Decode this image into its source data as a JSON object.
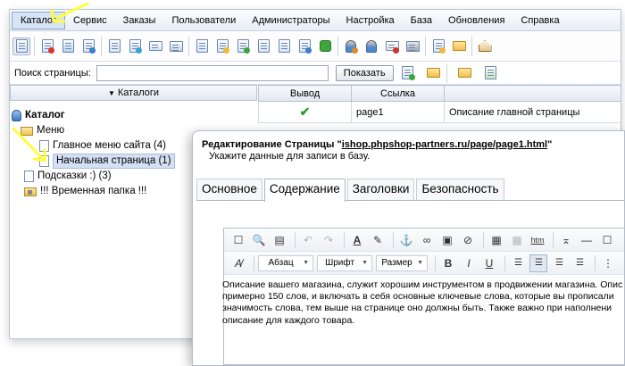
{
  "menu": {
    "items": [
      {
        "label": "Каталог",
        "active": true
      },
      {
        "label": "Сервис"
      },
      {
        "label": "Заказы"
      },
      {
        "label": "Пользователи"
      },
      {
        "label": "Администраторы"
      },
      {
        "label": "Настройка"
      },
      {
        "label": "База"
      },
      {
        "label": "Обновления"
      },
      {
        "label": "Справка"
      }
    ]
  },
  "toolbar": {
    "icons": [
      "catalog-page-icon",
      "red-list-icon",
      "category-icon",
      "page-refresh-icon",
      "page-blue-icon",
      "export-icon",
      "mail-icon",
      "phone-icon",
      "doc-icon",
      "folder-doc-icon",
      "green-arrow-doc-icon",
      "news-icon",
      "banner-icon",
      "links-icon",
      "puzzle-icon",
      "users-icon",
      "user-icon",
      "card-icon",
      "print-icon",
      "copy-icon",
      "export-folder-icon",
      "home-icon"
    ]
  },
  "search": {
    "label": "Поиск страницы:",
    "placeholder": "",
    "value": "",
    "button_label": "Показать"
  },
  "catalog": {
    "header_label": "Каталоги",
    "tree": [
      {
        "label": "Каталог",
        "icon": "database-icon"
      },
      {
        "label": "Меню",
        "icon": "folder-open-icon"
      },
      {
        "label": "Главное меню сайта (4)",
        "icon": "page-icon"
      },
      {
        "label": "Начальная страница (1)",
        "icon": "page-icon",
        "selected": true
      },
      {
        "label": "Подсказки :) (3)",
        "icon": "page-icon"
      },
      {
        "label": "!!! Временная папка !!!",
        "icon": "locked-folder-icon"
      }
    ]
  },
  "grid": {
    "headers": [
      "Вывод",
      "Ссылка",
      ""
    ],
    "rows": [
      {
        "output": "✔",
        "link": "page1",
        "description": "Описание главной страницы"
      }
    ]
  },
  "dialog": {
    "title_prefix": "Редактирование Страницы \"",
    "title_link": "ishop.phpshop-partners.ru/page/page1.html",
    "title_suffix": "\"",
    "subtitle": "Укажите данные для записи в базу.",
    "tabs": [
      {
        "label": "Основное"
      },
      {
        "label": "Содержание",
        "active": true
      },
      {
        "label": "Заголовки"
      },
      {
        "label": "Безопасность"
      }
    ],
    "editor": {
      "format_label": "Абзац",
      "font_label": "Шрифт",
      "size_label": "Размер",
      "content_lines": [
        "Описание вашего магазина, служит хорошим инструментом в продвижении магазина. Опис",
        "примерно 150 слов, и включать в себя основные ключевые слова, которые вы прописали",
        "значимость слова, тем выше на странице оно должны быть. Также важно при наполнени",
        "описание для каждого товара."
      ]
    }
  },
  "colors": {
    "annotation_arrow": "#ffff3c",
    "check_green": "#2e9a2e",
    "selection": "#d5e1f3"
  }
}
